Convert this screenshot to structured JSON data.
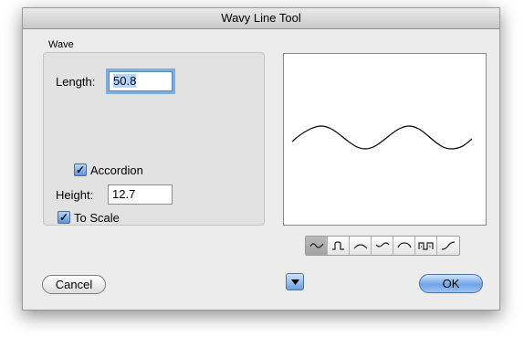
{
  "window": {
    "title": "Wavy Line Tool"
  },
  "wave_group": {
    "label": "Wave",
    "length_label": "Length:",
    "length_value": "50.8",
    "accordion_label": "Accordion",
    "accordion_checked": true,
    "height_label": "Height:",
    "height_value": "12.7",
    "to_scale_label": "To Scale",
    "to_scale_checked": true
  },
  "wave_styles": [
    {
      "icon": "sine-wave-icon",
      "selected": true
    },
    {
      "icon": "square-arch-icon",
      "selected": false
    },
    {
      "icon": "arc-icon",
      "selected": false
    },
    {
      "icon": "zigzag-wave-icon",
      "selected": false
    },
    {
      "icon": "half-arch-icon",
      "selected": false
    },
    {
      "icon": "square-wave-icon",
      "selected": false
    },
    {
      "icon": "s-curve-icon",
      "selected": false
    }
  ],
  "buttons": {
    "cancel": "Cancel",
    "ok": "OK"
  },
  "colors": {
    "accent": "#6fa4e6",
    "focus_ring": "#7eadd9",
    "selection": "#b5d5ff"
  }
}
